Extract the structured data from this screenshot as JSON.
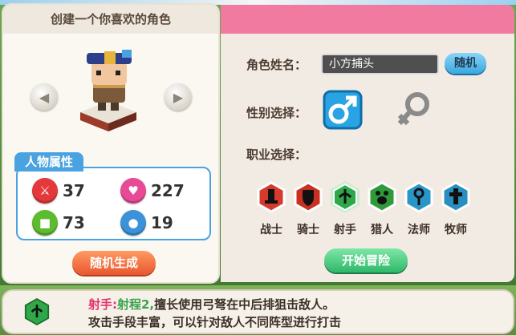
{
  "left_panel": {
    "title": "创建一个你喜欢的角色",
    "attributes_title": "人物属性",
    "stats": [
      {
        "icon": "sword-icon",
        "value": "37",
        "color": "#e4383a"
      },
      {
        "icon": "heart-icon",
        "value": "227",
        "color": "#e84a96"
      },
      {
        "icon": "shield-icon",
        "value": "73",
        "color": "#5dbb2f"
      },
      {
        "icon": "boot-icon",
        "value": "19",
        "color": "#3b92d8"
      }
    ],
    "random_generate_label": "随机生成"
  },
  "right_panel": {
    "name_label": "角色姓名：",
    "name_value": "小方捕头",
    "random_label": "随机",
    "gender_label": "性别选择：",
    "class_label": "职业选择：",
    "classes": [
      {
        "label": "战士",
        "color": "#d63a2c",
        "icon": "warrior-icon"
      },
      {
        "label": "骑士",
        "color": "#c93020",
        "icon": "knight-shield-icon"
      },
      {
        "label": "射手",
        "color": "#2fa84a",
        "icon": "archer-icon"
      },
      {
        "label": "猎人",
        "color": "#2f9a3a",
        "icon": "paw-icon"
      },
      {
        "label": "法师",
        "color": "#2a96c8",
        "icon": "mage-icon"
      },
      {
        "label": "牧师",
        "color": "#2a8fbf",
        "icon": "priest-icon"
      }
    ],
    "selected_class": "射手",
    "start_label": "开始冒险"
  },
  "description": {
    "class_name": "射手:",
    "range": "射程2,",
    "line1_rest": "擅长使用弓弩在中后排狙击敌人。",
    "line2": "攻击手段丰富，可以针对敌人不同阵型进行打击"
  }
}
